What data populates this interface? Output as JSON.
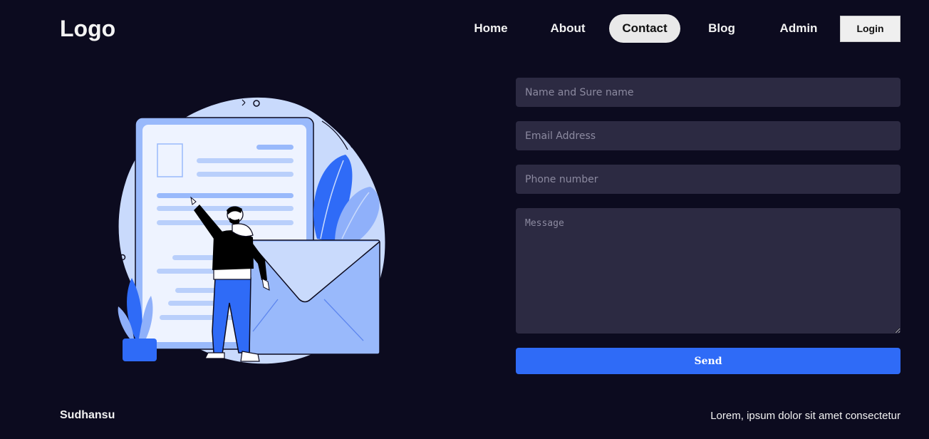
{
  "header": {
    "logo": "Logo",
    "nav": [
      {
        "label": "Home",
        "active": false
      },
      {
        "label": "About",
        "active": false
      },
      {
        "label": "Contact",
        "active": true
      },
      {
        "label": "Blog",
        "active": false
      },
      {
        "label": "Admin",
        "active": false
      }
    ],
    "login_label": "Login"
  },
  "illustration": {
    "icon": "contact-illustration",
    "colors": {
      "blob": "#c9dafc",
      "document": "#99b9fb",
      "document_paper": "#eef3ff",
      "lines": "#b9cffb",
      "accent": "#2f6bf7",
      "envelope": "#a9c4fc"
    }
  },
  "form": {
    "name_placeholder": "Name and Sure name",
    "email_placeholder": "Email Address",
    "phone_placeholder": "Phone number",
    "message_placeholder": "Message",
    "send_label": "Send"
  },
  "footer": {
    "left": "Sudhansu",
    "right": "Lorem, ipsum dolor sit amet consectetur"
  },
  "colors": {
    "background": "#0c0b1f",
    "input_bg": "#2c2a42",
    "primary": "#2f6bf7"
  }
}
